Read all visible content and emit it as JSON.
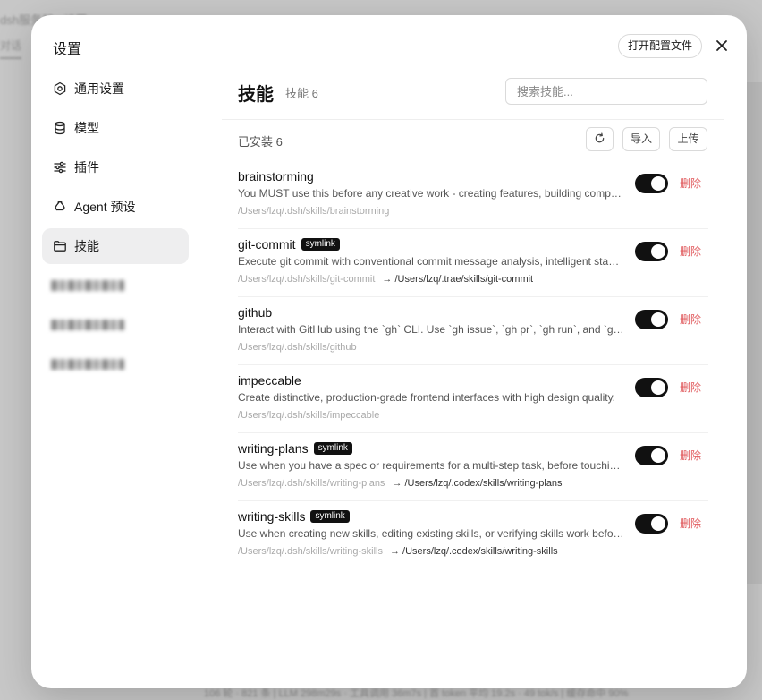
{
  "background": {
    "app_title": "dsh服务器 · 设置",
    "tab": "对话",
    "status": "106 轮 · 821 条 | LLM 298m29s · 工具调用 36m7s | 首 token 平均 19.2s · 49 tok/s | 缓存命中 90%"
  },
  "modal": {
    "title": "设置",
    "open_config_label": "打开配置文件",
    "close_icon": "close-icon"
  },
  "sidebar": {
    "items": [
      {
        "label": "通用设置",
        "icon": "gear-icon",
        "active": false
      },
      {
        "label": "模型",
        "icon": "database-icon",
        "active": false
      },
      {
        "label": "插件",
        "icon": "sliders-icon",
        "active": false
      },
      {
        "label": "Agent 预设",
        "icon": "recycle-icon",
        "active": false
      },
      {
        "label": "技能",
        "icon": "folder-icon",
        "active": true
      }
    ],
    "blurred_count": 3
  },
  "main": {
    "title": "技能",
    "count_label": "技能 6",
    "search_placeholder": "搜索技能...",
    "installed_label": "已安装 6",
    "import_label": "导入",
    "upload_label": "上传",
    "delete_label": "删除",
    "skills": [
      {
        "name": "brainstorming",
        "symlink": "",
        "description": "You MUST use this before any creative work - creating features, building components, adding functionality, or modifying behavior.",
        "path": "/Users/lzq/.dsh/skills/brainstorming",
        "target": "",
        "enabled": true
      },
      {
        "name": "git-commit",
        "symlink": "symlink",
        "description": "Execute git commit with conventional commit message analysis, intelligent staging, and message generation.",
        "path": "/Users/lzq/.dsh/skills/git-commit",
        "target": "/Users/lzq/.trae/skills/git-commit",
        "enabled": true
      },
      {
        "name": "github",
        "symlink": "",
        "description": "Interact with GitHub using the `gh` CLI. Use `gh issue`, `gh pr`, `gh run`, and `gh api` for issues and PRs.",
        "path": "/Users/lzq/.dsh/skills/github",
        "target": "",
        "enabled": true
      },
      {
        "name": "impeccable",
        "symlink": "",
        "description": "Create distinctive, production-grade frontend interfaces with high design quality.",
        "path": "/Users/lzq/.dsh/skills/impeccable",
        "target": "",
        "enabled": true
      },
      {
        "name": "writing-plans",
        "symlink": "symlink",
        "description": "Use when you have a spec or requirements for a multi-step task, before touching code.",
        "path": "/Users/lzq/.dsh/skills/writing-plans",
        "target": "/Users/lzq/.codex/skills/writing-plans",
        "enabled": true
      },
      {
        "name": "writing-skills",
        "symlink": "symlink",
        "description": "Use when creating new skills, editing existing skills, or verifying skills work before deployment.",
        "path": "/Users/lzq/.dsh/skills/writing-skills",
        "target": "/Users/lzq/.codex/skills/writing-skills",
        "enabled": true
      }
    ]
  },
  "colors": {
    "accent": "#111111",
    "danger": "#e0575a",
    "active_bg": "#eeeeef"
  }
}
